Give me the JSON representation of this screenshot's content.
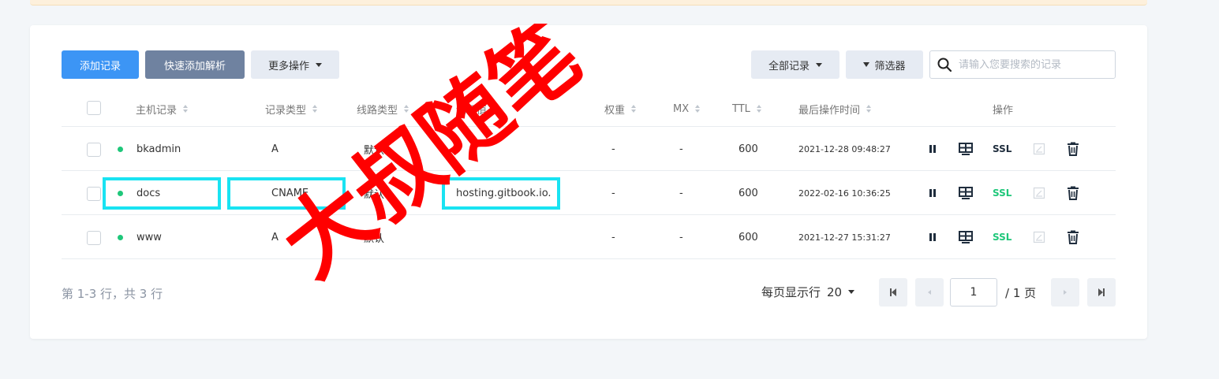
{
  "toolbar": {
    "add_record": "添加记录",
    "quick_add": "快速添加解析",
    "more_actions": "更多操作",
    "all_records": "全部记录",
    "filter": "筛选器",
    "search_placeholder": "请输入您要搜索的记录"
  },
  "table": {
    "headers": {
      "host": "主机记录",
      "type": "记录类型",
      "line": "线路类型",
      "value": "记录值",
      "weight": "权重",
      "mx": "MX",
      "ttl": "TTL",
      "time": "最后操作时间",
      "actions": "操作"
    },
    "rows": [
      {
        "host": "bkadmin",
        "type": "A",
        "line": "默认",
        "value": "",
        "weight": "-",
        "mx": "-",
        "ttl": "600",
        "time": "2021-12-28 09:48:27",
        "ssl": "SSL",
        "ssl_color": "#1f2d3d"
      },
      {
        "host": "docs",
        "type": "CNAME",
        "line": "默认",
        "value": "hosting.gitbook.io.",
        "weight": "-",
        "mx": "-",
        "ttl": "600",
        "time": "2022-02-16 10:36:25",
        "ssl": "SSL",
        "ssl_color": "#1fc77a"
      },
      {
        "host": "www",
        "type": "A",
        "line": "默认",
        "value": "",
        "weight": "-",
        "mx": "-",
        "ttl": "600",
        "time": "2021-12-27 15:31:27",
        "ssl": "SSL",
        "ssl_color": "#1fc77a"
      }
    ]
  },
  "footer": {
    "summary": "第 1-3 行，共 3 行",
    "page_size_label": "每页显示行",
    "page_size": "20",
    "current_page": "1",
    "total_pages": "/ 1 页"
  },
  "watermark": "大叔随笔",
  "colors": {
    "primary": "#3c95f5",
    "status_on": "#1fc77a",
    "highlight": "#19e3f2",
    "watermark": "#ff0000"
  }
}
